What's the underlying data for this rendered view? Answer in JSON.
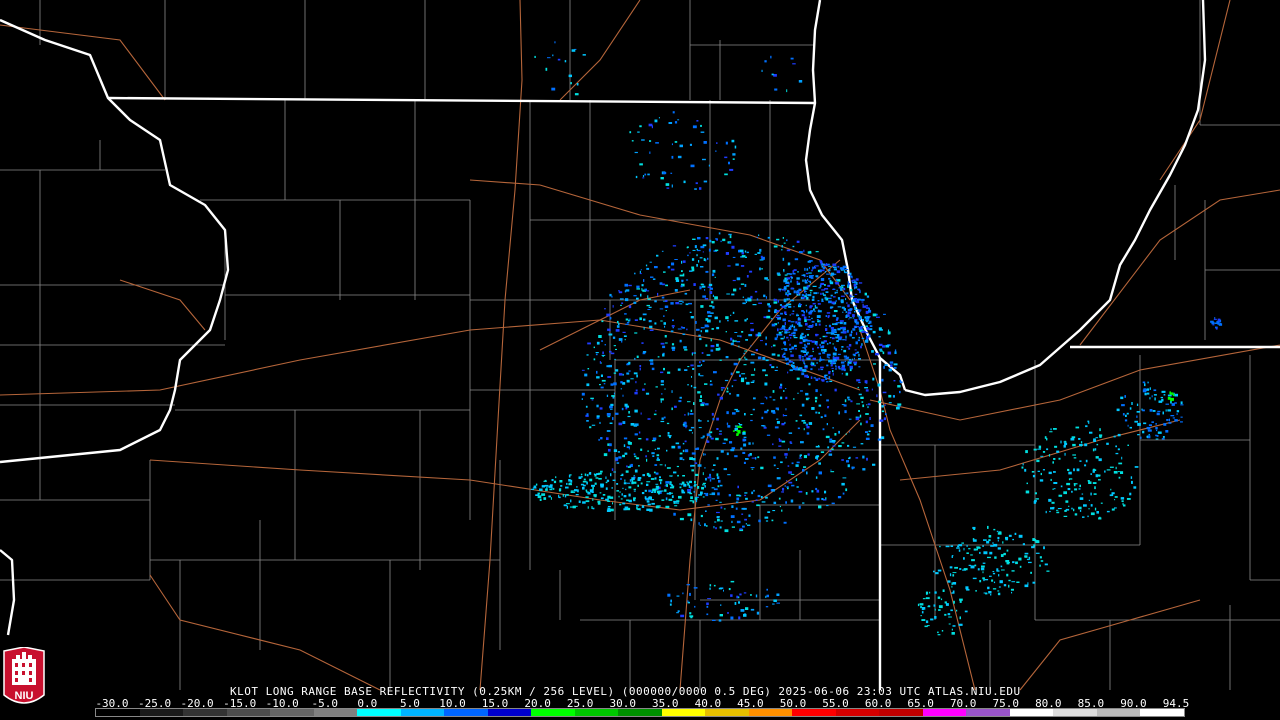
{
  "product_caption": "KLOT LONG RANGE BASE REFLECTIVITY (0.25KM / 256 LEVEL) (000000/0000 0.5 DEG) 2025-06-06 23:03 UTC  ATLAS.NIU.EDU",
  "scale": {
    "labels": [
      "-30.0",
      "-25.0",
      "-20.0",
      "-15.0",
      "-10.0",
      "-5.0",
      "0.0",
      "5.0",
      "10.0",
      "15.0",
      "20.0",
      "25.0",
      "30.0",
      "35.0",
      "40.0",
      "45.0",
      "50.0",
      "55.0",
      "60.0",
      "65.0",
      "70.0",
      "75.0",
      "80.0",
      "85.0",
      "90.0",
      "94.5"
    ],
    "colors": [
      "#000000",
      "#1a1a1a",
      "#333333",
      "#4d4d4d",
      "#666666",
      "#808080",
      "#00ffff",
      "#00b4ff",
      "#0066ff",
      "#0000cc",
      "#00ff00",
      "#00c800",
      "#009000",
      "#ffff00",
      "#e6c000",
      "#ff9000",
      "#ff0000",
      "#d40000",
      "#c00000",
      "#ff00ff",
      "#9955c9",
      "#ffffff",
      "#dddddd",
      "#bbbbbb",
      "#ffffff"
    ]
  },
  "logo": {
    "text": "NIU",
    "color": "#c8102e"
  },
  "map": {
    "state_border_color": "#ffffff",
    "county_line_color": "#8a8a8a",
    "highway_color": "#b5653a",
    "background_color": "#000000"
  }
}
